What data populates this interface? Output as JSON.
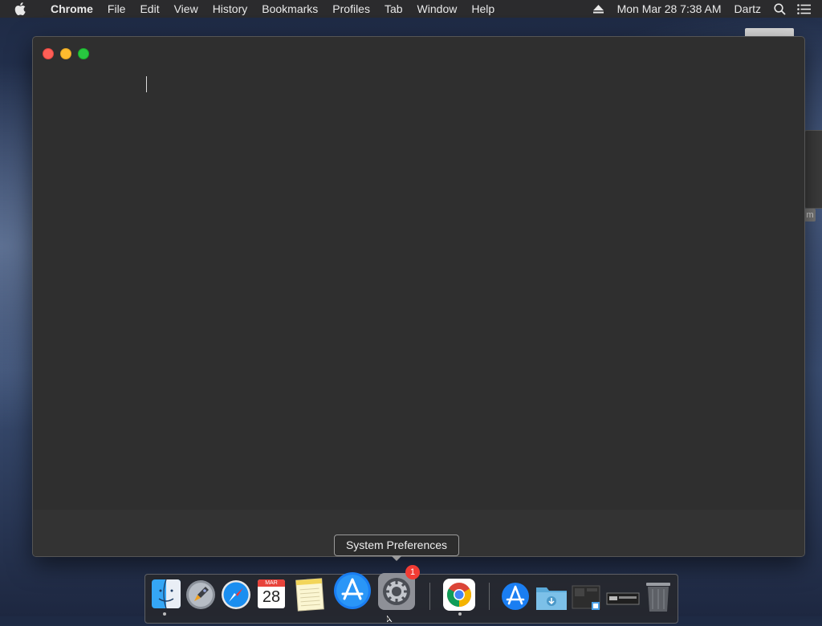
{
  "menubar": {
    "app_name": "Chrome",
    "menus": [
      "File",
      "Edit",
      "View",
      "History",
      "Bookmarks",
      "Profiles",
      "Tab",
      "Window",
      "Help"
    ],
    "datetime": "Mon Mar 28  7:38 AM",
    "user": "Dartz"
  },
  "tooltip": {
    "text": "System Preferences"
  },
  "dock": {
    "calendar": {
      "month": "MAR",
      "day": "28"
    },
    "system_prefs_badge": "1"
  },
  "background": {
    "tag": "m"
  },
  "colors": {
    "close": "#fe5f57",
    "minimize": "#febc2e",
    "maximize": "#28c840",
    "badge": "#f23c34"
  }
}
